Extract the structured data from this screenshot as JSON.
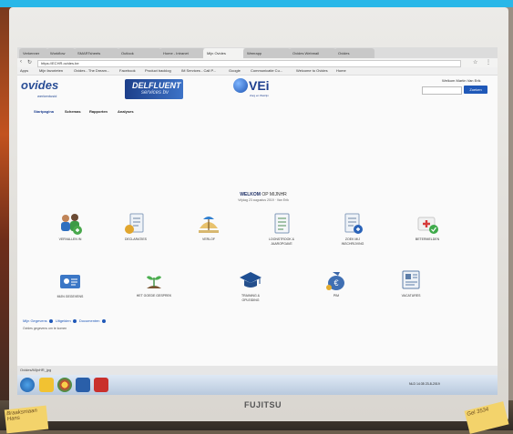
{
  "browser": {
    "tabs": [
      {
        "label": "Verkenner"
      },
      {
        "label": "Workflow"
      },
      {
        "label": "SMARTsheets"
      },
      {
        "label": "Outlook"
      },
      {
        "label": "Home - Intranet"
      },
      {
        "label": "Mijn Ovides"
      },
      {
        "label": "Weerapp"
      },
      {
        "label": "Ovides Webmail"
      },
      {
        "label": "Ovides"
      }
    ],
    "url": "https://ECHR.ovides.be",
    "bookmarks": [
      "Apps",
      "Mijn favorieten",
      "Ovides - The Dream...",
      "Facebook",
      "Product backlog",
      "IM Services - Call P...",
      "Google",
      "Communicatie Cu...",
      "Welcome to Ovides",
      "Home"
    ]
  },
  "header": {
    "logo_ovides": "ovides",
    "logo_ovides_sub": "werkentusid",
    "logo_dels_main": "DELFLUENT",
    "logo_dels_sub": "services bv",
    "logo_vei": "VEi",
    "logo_vei_sub": "Zorg en Welzijn",
    "user_line": "Welkom Martin Van Erik",
    "search_placeholder": "",
    "search_button": "Zoeken"
  },
  "nav": {
    "items": [
      "Startpagina",
      "Schemas",
      "Rapporten",
      "Analyses"
    ]
  },
  "welcome": {
    "title_bold": "WELKOM",
    "title_rest": "OP MIJNHR",
    "subtitle": "Vrijdag 23 augustus 2019 · Van Erik"
  },
  "tiles": [
    {
      "label": "VERVALLEN IN",
      "icon": "people-icon"
    },
    {
      "label": "DECLARATIES",
      "icon": "receipt-icon"
    },
    {
      "label": "VERLOF",
      "icon": "beach-icon"
    },
    {
      "label": "LOONSTROOK & JAAROPGAVE",
      "icon": "payslip-icon"
    },
    {
      "label": "ZOEK MIJ INSCHRIJVING",
      "icon": "document-icon"
    },
    {
      "label": "BETERMELDEN",
      "icon": "medical-kit-icon"
    },
    {
      "label": "MIJN GEGEVENS",
      "icon": "id-card-icon"
    },
    {
      "label": "HET GOEDE GESPREK",
      "icon": "growth-icon"
    },
    {
      "label": "TRAINING & OPLEIDING",
      "icon": "graduation-icon"
    },
    {
      "label": "PIM",
      "icon": "money-bag-icon"
    },
    {
      "label": "VACATURES",
      "icon": "newspaper-icon"
    }
  ],
  "footer_links": [
    "Mijn Gegevens",
    "Uitgelden",
    "Documenten"
  ],
  "status_text": "Ovides gegevens om te komen",
  "status_strip": "Ovides/MijnHR_jpg",
  "taskbar": {
    "tray": "NLD  14:35  23-8-2019"
  },
  "monitor_brand": "FUJITSU",
  "sticky_notes": {
    "left": "Braaksmaan Hans",
    "right": "Gel 3534"
  },
  "colors": {
    "accent_blue": "#1f58b8",
    "brand_navy": "#1e3f8f",
    "screen_bg": "#fafafa",
    "photo_top_band": "#29b7e8"
  }
}
